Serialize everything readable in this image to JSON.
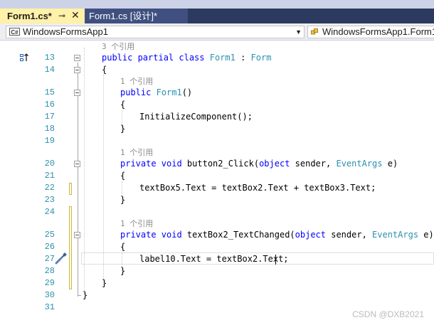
{
  "tabs": [
    {
      "label": "Form1.cs*",
      "pin": "⊸",
      "close": "✕"
    },
    {
      "label": "Form1.cs [设计]*"
    }
  ],
  "nav": {
    "project": "WindowsFormsApp1",
    "class": "WindowsFormsApp1.Form1",
    "project_icon_text": "C#"
  },
  "code": {
    "lines": [
      {
        "n": "13",
        "lens": "3 个引用"
      },
      {
        "n": "14"
      },
      {
        "n": "15",
        "lens": "1 个引用"
      },
      {
        "n": "16"
      },
      {
        "n": "17"
      },
      {
        "n": "18"
      },
      {
        "n": "19"
      },
      {
        "n": "20",
        "lens": "1 个引用"
      },
      {
        "n": "21"
      },
      {
        "n": "22"
      },
      {
        "n": "23"
      },
      {
        "n": "24"
      },
      {
        "n": "25",
        "lens": "1 个引用"
      },
      {
        "n": "26"
      },
      {
        "n": "27"
      },
      {
        "n": "28"
      },
      {
        "n": "29"
      },
      {
        "n": "30"
      },
      {
        "n": "31"
      }
    ],
    "text": {
      "l13_kw": "public partial class ",
      "l13_name": "Form1",
      "l13_sep": " : ",
      "l13_base": "Form",
      "l14": "{",
      "l15_kw": "public ",
      "l15_name": "Form1",
      "l15_rest": "()",
      "l16": "{",
      "l17": "InitializeComponent();",
      "l18": "}",
      "l20_kw": "private void ",
      "l20_name": "button2_Click(",
      "l20_kw2": "object",
      "l20_mid": " sender, ",
      "l20_ty": "EventArgs",
      "l20_end": " e)",
      "l21": "{",
      "l22": "textBox5.Text = textBox2.Text + textBox3.Text;",
      "l23": "}",
      "l25_kw": "private void ",
      "l25_name": "textBox2_TextChanged(",
      "l25_kw2": "object",
      "l25_mid": " sender, ",
      "l25_ty": "EventArgs",
      "l25_end": " e)",
      "l26": "{",
      "l27": "label10.Text = textBox2.Text;",
      "l28": "}",
      "l29": "}",
      "l30": "}"
    }
  },
  "watermark": "CSDN @DXB2021",
  "colors": {
    "keyword": "#0000ff",
    "type": "#2b91af",
    "line_number": "#2b91af",
    "active_tab": "#fff1a8",
    "tab_strip": "#2b3a5e"
  },
  "icons": [
    "pin-icon",
    "close-icon",
    "csharp-project-icon",
    "class-icon",
    "chevron-down-icon",
    "override-glyph-icon",
    "quick-action-icon"
  ]
}
